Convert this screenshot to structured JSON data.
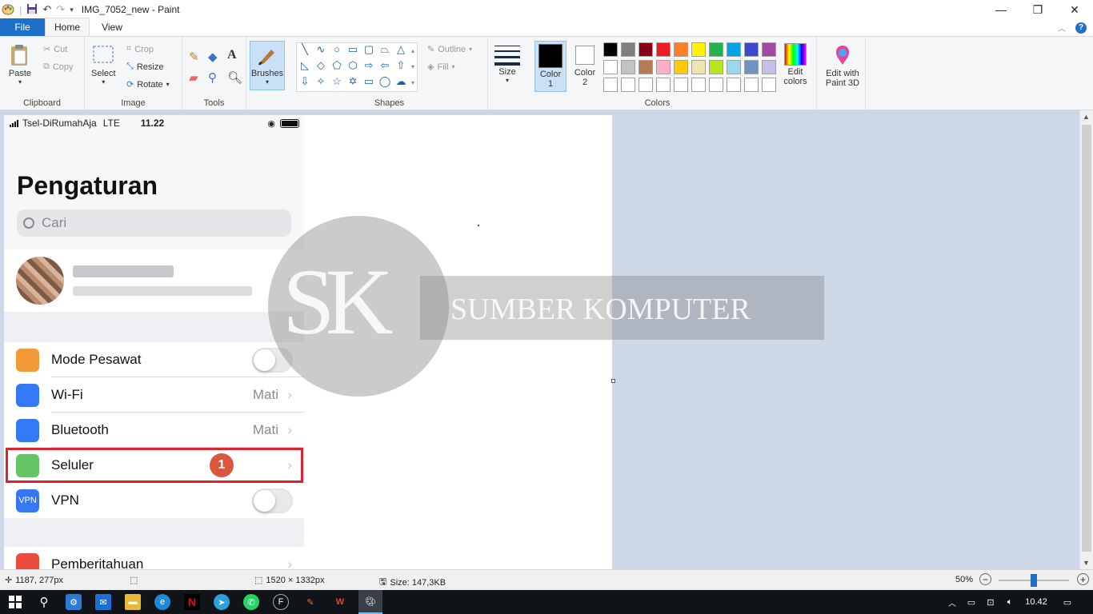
{
  "window": {
    "title": "IMG_7052_new - Paint",
    "controls": [
      "minimize-icon",
      "restore-icon",
      "close-icon"
    ]
  },
  "tabs": {
    "file": "File",
    "home": "Home",
    "view": "View"
  },
  "ribbon": {
    "clipboard": {
      "label": "Clipboard",
      "paste": "Paste",
      "cut": "Cut",
      "copy": "Copy"
    },
    "image": {
      "label": "Image",
      "select": "Select",
      "crop": "Crop",
      "resize": "Resize",
      "rotate": "Rotate"
    },
    "tools": {
      "label": "Tools"
    },
    "brushes": {
      "label": "Brushes"
    },
    "shapes": {
      "label": "Shapes",
      "outline": "Outline",
      "fill": "Fill"
    },
    "size": {
      "label": "Size"
    },
    "colors": {
      "label": "Colors",
      "color1": "Color 1",
      "color2": "Color 2",
      "edit_colors": "Edit colors",
      "edit_paint3d": "Edit with Paint 3D",
      "palette_row1": [
        "#000000",
        "#7f7f7f",
        "#880015",
        "#ed1c24",
        "#ff7f27",
        "#fff200",
        "#22b14c",
        "#00a2e8",
        "#3f48cc",
        "#a349a4"
      ],
      "palette_row2": [
        "#ffffff",
        "#c3c3c3",
        "#b97a57",
        "#ffaec9",
        "#ffc90e",
        "#efe4b0",
        "#b5e61d",
        "#99d9ea",
        "#7092be",
        "#c8bfe7"
      ]
    }
  },
  "phone": {
    "carrier": "Tsel-DiRumahAja",
    "network": "LTE",
    "time": "11.22",
    "page_title": "Pengaturan",
    "search_placeholder": "Cari",
    "rows": [
      {
        "label": "Mode Pesawat",
        "value": "",
        "icon": "airplane-icon",
        "color": "#f19a37",
        "kind": "toggle"
      },
      {
        "label": "Wi-Fi",
        "value": "Mati",
        "icon": "wifi-icon",
        "color": "#3478f6",
        "kind": "chevron"
      },
      {
        "label": "Bluetooth",
        "value": "Mati",
        "icon": "bluetooth-icon",
        "color": "#3478f6",
        "kind": "chevron"
      },
      {
        "label": "Seluler",
        "value": "",
        "icon": "antenna-icon",
        "color": "#65c466",
        "kind": "chevron"
      },
      {
        "label": "VPN",
        "value": "",
        "icon": "vpn-icon",
        "color": "#3478f6",
        "kind": "toggle",
        "icon_text": "VPN"
      },
      {
        "label": "Pemberitahuan",
        "value": "",
        "icon": "notification-icon",
        "color": "#eb4d3d",
        "kind": "chevron"
      }
    ],
    "step_badge": "1",
    "highlight_color": "#d9262e"
  },
  "watermark": {
    "logo_letters": "SK",
    "text": "SUMBER KOMPUTER"
  },
  "status": {
    "cursor_pos": "1187, 277px",
    "dimensions": "1520 × 1332px",
    "size": "Size: 147,3KB",
    "zoom": "50%",
    "zoom_level": 0.5
  },
  "taskbar": {
    "clock": "10.42"
  }
}
